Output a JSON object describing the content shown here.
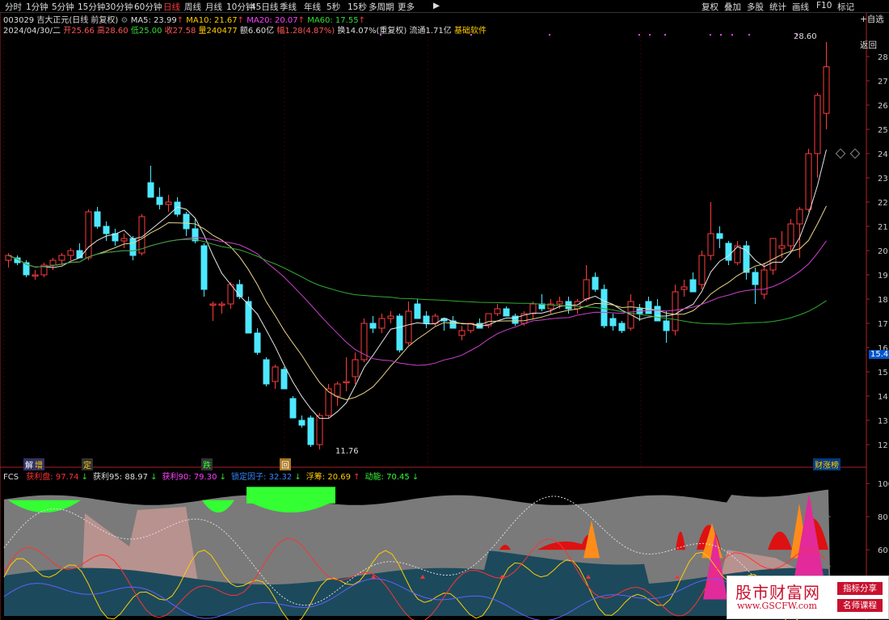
{
  "toolbar": {
    "timeframes": [
      "分时",
      "1分钟",
      "5分钟",
      "15分钟",
      "30分钟",
      "60分钟",
      "日线",
      "周线",
      "月线",
      "10分钟",
      "45日线",
      "季线",
      "年线",
      "5秒",
      "15秒",
      "多周期",
      "更多"
    ],
    "active_timeframe": "日线",
    "right_buttons": [
      "复权",
      "叠加",
      "多股",
      "统计",
      "画线",
      "F10",
      "标记",
      "+自选",
      "返回"
    ]
  },
  "stock": {
    "line1_prefix": "003029 吉大正元(日线 前复权)",
    "ma5": "MA5: 23.99",
    "ma10": "MA10: 21.67",
    "ma20": "MA20: 20.07",
    "ma60": "MA60: 17.55",
    "date": "2024/04/30/二",
    "open": "开25.66",
    "high": "高28.60",
    "low": "低25.00",
    "close": "收27.58",
    "volume": "量240477",
    "amount": "额6.60亿",
    "change": "幅1.28(4.87%)",
    "turnover": "换14.07%(重复权)",
    "float": "流通1.71亿",
    "tag": "基础软件"
  },
  "price_axis": {
    "labels": [
      "28",
      "27",
      "26",
      "25",
      "24",
      "23",
      "22",
      "21",
      "20",
      "19",
      "18",
      "17",
      "16",
      "15",
      "14",
      "13",
      "12"
    ],
    "current": "15.46"
  },
  "annotations": {
    "high_label": "28.60",
    "low_label": "11.76",
    "events": [
      "解",
      "增",
      "定",
      "跌",
      "回"
    ],
    "bottom_right": "财涨榜"
  },
  "indicator": {
    "name": "FCS",
    "items": [
      {
        "label": "获利盘",
        "value": "97.74",
        "arrow": "↓",
        "color": "#ff3333"
      },
      {
        "label": "获利95",
        "value": "88.97",
        "arrow": "↓",
        "color": "#dddddd"
      },
      {
        "label": "获利90",
        "value": "79.30",
        "arrow": "↓",
        "color": "#ff40ff"
      },
      {
        "label": "锁定因子",
        "value": "32.32",
        "arrow": "↓",
        "color": "#3388ff"
      },
      {
        "label": "浮筹",
        "value": "20.69",
        "arrow": "↑",
        "color": "#ffcc00"
      },
      {
        "label": "动能",
        "value": "70.45",
        "arrow": "↓",
        "color": "#33ff33"
      }
    ],
    "axis": [
      "100",
      "80",
      "60",
      "40"
    ]
  },
  "watermark": {
    "title": "股市财富网",
    "url": "www.GSCFW.com",
    "badge1": "指标分享",
    "badge2": "名师课程"
  },
  "chart_data": {
    "type": "candlestick",
    "y_range": [
      11.5,
      29
    ],
    "candles": [
      [
        19.6,
        19.9,
        19.3,
        19.8
      ],
      [
        19.7,
        19.8,
        19.4,
        19.5
      ],
      [
        19.5,
        19.6,
        18.9,
        19.0
      ],
      [
        19.0,
        19.2,
        18.8,
        19.0
      ],
      [
        19.0,
        19.5,
        18.9,
        19.4
      ],
      [
        19.4,
        19.7,
        19.2,
        19.6
      ],
      [
        19.6,
        19.9,
        19.4,
        19.8
      ],
      [
        19.8,
        20.1,
        19.6,
        20.0
      ],
      [
        20.0,
        20.3,
        19.7,
        19.7
      ],
      [
        19.7,
        21.7,
        19.6,
        21.6
      ],
      [
        21.6,
        21.8,
        20.9,
        21.0
      ],
      [
        21.0,
        21.2,
        20.4,
        20.7
      ],
      [
        20.7,
        20.9,
        20.2,
        20.4
      ],
      [
        20.4,
        20.7,
        20.1,
        20.5
      ],
      [
        20.5,
        20.6,
        19.6,
        19.8
      ],
      [
        19.9,
        21.5,
        19.8,
        21.4
      ],
      [
        22.8,
        23.5,
        22.2,
        22.2
      ],
      [
        22.2,
        22.6,
        21.7,
        21.9
      ],
      [
        21.9,
        22.3,
        21.6,
        22.0
      ],
      [
        22.0,
        22.2,
        21.4,
        21.5
      ],
      [
        21.5,
        21.6,
        20.6,
        20.9
      ],
      [
        20.9,
        21.3,
        20.3,
        20.4
      ],
      [
        20.2,
        20.3,
        18.1,
        18.4
      ],
      [
        17.8,
        17.9,
        17.1,
        17.8
      ],
      [
        17.8,
        17.9,
        17.4,
        17.8
      ],
      [
        17.8,
        18.7,
        17.6,
        18.6
      ],
      [
        18.6,
        18.8,
        18.0,
        18.1
      ],
      [
        17.9,
        18.1,
        16.6,
        16.6
      ],
      [
        16.6,
        16.8,
        15.7,
        15.8
      ],
      [
        15.5,
        15.6,
        14.4,
        14.5
      ],
      [
        14.6,
        15.3,
        14.3,
        15.2
      ],
      [
        15.1,
        15.2,
        14.3,
        14.3
      ],
      [
        13.9,
        14.0,
        13.1,
        13.1
      ],
      [
        13.0,
        13.2,
        12.7,
        12.8
      ],
      [
        13.1,
        13.2,
        11.9,
        12.0
      ],
      [
        12.0,
        13.3,
        11.8,
        13.2
      ],
      [
        13.2,
        14.5,
        13.1,
        14.3
      ],
      [
        14.0,
        14.6,
        13.6,
        14.5
      ],
      [
        14.6,
        15.6,
        14.2,
        14.6
      ],
      [
        14.8,
        15.8,
        14.5,
        15.5
      ],
      [
        15.5,
        17.2,
        15.4,
        17.0
      ],
      [
        17.0,
        17.3,
        16.6,
        16.8
      ],
      [
        16.8,
        17.4,
        16.6,
        17.2
      ],
      [
        17.2,
        17.5,
        17.0,
        17.3
      ],
      [
        17.3,
        17.4,
        15.8,
        15.9
      ],
      [
        16.2,
        17.9,
        16.1,
        17.5
      ],
      [
        17.8,
        18.0,
        17.3,
        17.2
      ],
      [
        17.3,
        17.5,
        16.8,
        17.0
      ],
      [
        17.0,
        17.4,
        16.9,
        17.3
      ],
      [
        17.2,
        17.2,
        16.7,
        17.1
      ],
      [
        17.1,
        17.3,
        16.8,
        16.8
      ],
      [
        16.5,
        16.9,
        16.3,
        16.7
      ],
      [
        16.7,
        17.0,
        16.6,
        17.0
      ],
      [
        17.0,
        17.2,
        16.8,
        16.8
      ],
      [
        16.9,
        17.4,
        16.8,
        17.4
      ],
      [
        17.4,
        17.8,
        17.3,
        17.6
      ],
      [
        17.6,
        17.7,
        17.3,
        17.3
      ],
      [
        17.3,
        17.4,
        16.9,
        17.0
      ],
      [
        17.0,
        17.5,
        16.9,
        17.4
      ],
      [
        17.4,
        17.9,
        17.2,
        17.8
      ],
      [
        17.8,
        18.2,
        17.5,
        17.6
      ],
      [
        17.6,
        18.0,
        17.4,
        17.8
      ],
      [
        17.8,
        18.1,
        17.6,
        17.9
      ],
      [
        17.9,
        18.1,
        17.4,
        17.6
      ],
      [
        17.6,
        18.0,
        17.4,
        17.9
      ],
      [
        18.0,
        19.4,
        17.9,
        18.8
      ],
      [
        18.9,
        19.1,
        18.3,
        18.4
      ],
      [
        18.4,
        18.6,
        16.8,
        16.9
      ],
      [
        17.2,
        17.4,
        16.7,
        16.9
      ],
      [
        17.0,
        17.1,
        16.6,
        16.7
      ],
      [
        16.8,
        18.2,
        16.7,
        17.9
      ],
      [
        17.6,
        17.8,
        17.1,
        17.4
      ],
      [
        17.9,
        18.1,
        17.4,
        17.4
      ],
      [
        17.7,
        18.0,
        17.4,
        17.1
      ],
      [
        17.1,
        17.5,
        16.2,
        16.7
      ],
      [
        16.7,
        18.6,
        16.5,
        18.3
      ],
      [
        18.4,
        18.8,
        18.1,
        18.5
      ],
      [
        18.8,
        19.1,
        18.5,
        18.3
      ],
      [
        18.6,
        20.0,
        18.4,
        19.8
      ],
      [
        19.8,
        22.0,
        19.6,
        20.7
      ],
      [
        20.7,
        21.0,
        20.1,
        20.5
      ],
      [
        20.3,
        20.4,
        19.4,
        19.6
      ],
      [
        19.5,
        20.4,
        19.4,
        20.2
      ],
      [
        20.2,
        20.4,
        18.8,
        19.1
      ],
      [
        19.1,
        19.3,
        17.8,
        18.6
      ],
      [
        18.2,
        19.5,
        18.0,
        19.2
      ],
      [
        19.2,
        20.5,
        19.0,
        20.5
      ],
      [
        20.1,
        20.8,
        19.7,
        20.2
      ],
      [
        20.2,
        21.3,
        20.0,
        21.1
      ],
      [
        21.1,
        21.8,
        19.7,
        21.7
      ],
      [
        21.7,
        24.2,
        21.6,
        24.0
      ],
      [
        24.0,
        26.5,
        23.0,
        26.4
      ],
      [
        25.66,
        28.6,
        25.0,
        27.58
      ]
    ]
  }
}
